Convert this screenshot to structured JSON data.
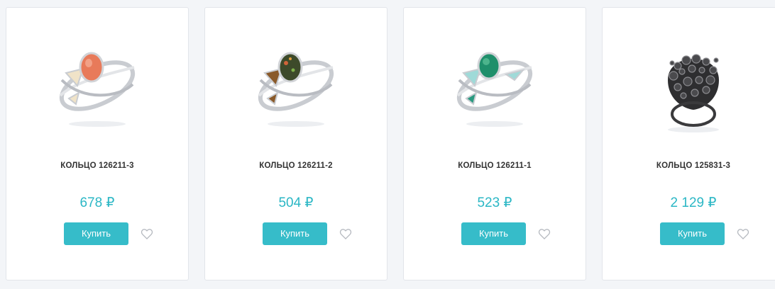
{
  "products": [
    {
      "name": "КОЛЬЦО 126211-3",
      "price": "678 ₽",
      "buy_label": "Купить",
      "stone_color": "#e87a5a",
      "image_icon": "ring-image-icon"
    },
    {
      "name": "КОЛЬЦО 126211-2",
      "price": "504 ₽",
      "buy_label": "Купить",
      "stone_color": "#3d4a2a",
      "image_icon": "ring-image-icon"
    },
    {
      "name": "КОЛЬЦО 126211-1",
      "price": "523 ₽",
      "buy_label": "Купить",
      "stone_color": "#1f8f6b",
      "image_icon": "ring-image-icon"
    },
    {
      "name": "КОЛЬЦО 125831-3",
      "price": "2 129 ₽",
      "buy_label": "Купить",
      "stone_color": "#3a3a3a",
      "image_icon": "ring-image-icon"
    }
  ],
  "icons": {
    "favorite": "heart-outline-icon"
  },
  "colors": {
    "accent": "#36bcc9",
    "price": "#2bb7c5"
  }
}
